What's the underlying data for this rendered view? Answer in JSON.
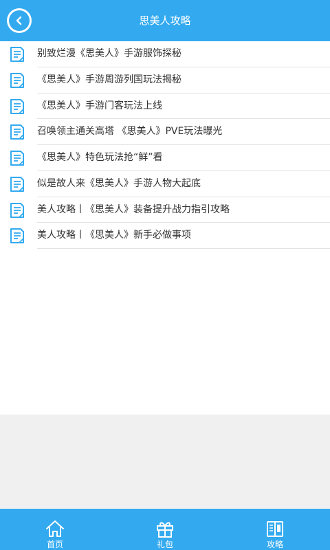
{
  "header": {
    "title": "思美人攻略"
  },
  "colors": {
    "accent": "#33aaf0",
    "background": "#f0f0f0"
  },
  "articles": [
    {
      "title": "别致烂漫《思美人》手游服饰探秘"
    },
    {
      "title": "《思美人》手游周游列国玩法揭秘"
    },
    {
      "title": "《思美人》手游门客玩法上线"
    },
    {
      "title": "召唤领主通关高塔 《思美人》PVE玩法曝光"
    },
    {
      "title": "《思美人》特色玩法抢“鲜”看"
    },
    {
      "title": "似是故人来《思美人》手游人物大起底"
    },
    {
      "title": "美人攻略丨《思美人》装备提升战力指引攻略"
    },
    {
      "title": "美人攻略丨《思美人》新手必做事项"
    }
  ],
  "tabs": [
    {
      "label": "首页",
      "icon": "home-icon"
    },
    {
      "label": "礼包",
      "icon": "gift-icon"
    },
    {
      "label": "攻略",
      "icon": "book-icon"
    }
  ]
}
